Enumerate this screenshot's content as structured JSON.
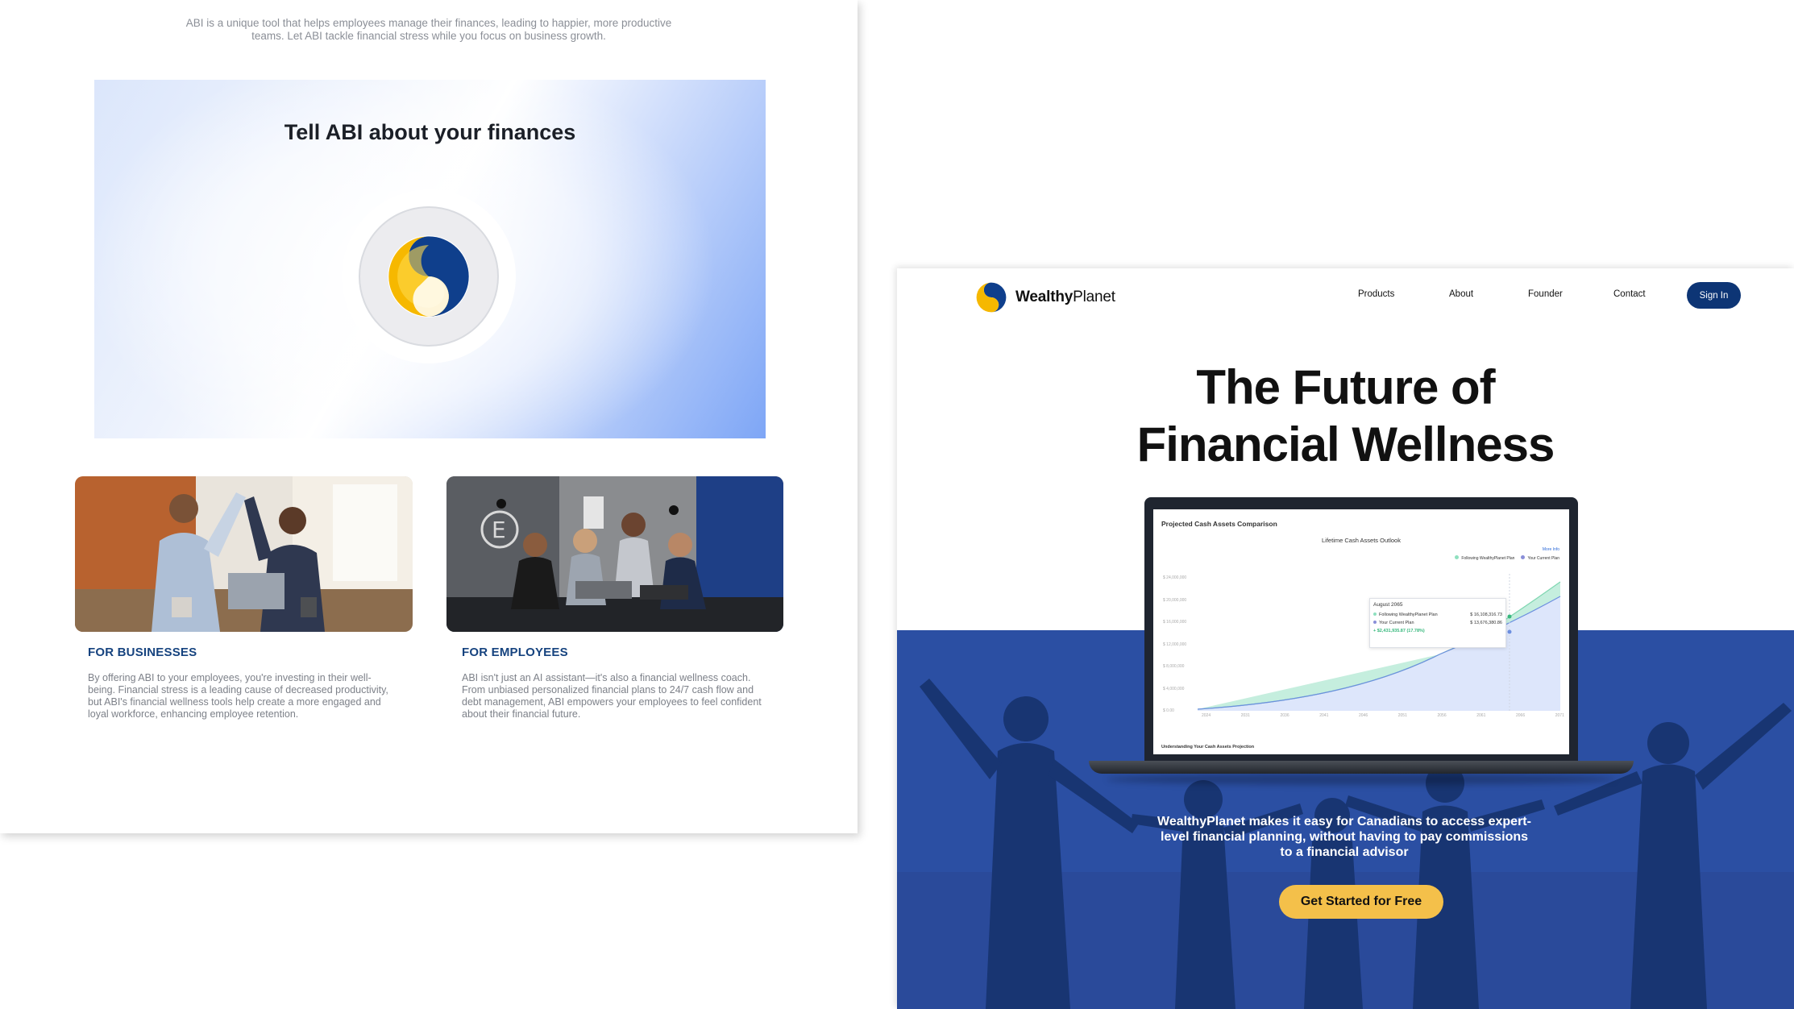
{
  "left": {
    "intro": "ABI is a unique tool that helps employees manage their finances, leading to happier, more productive teams. Let ABI tackle financial stress while you focus on business growth.",
    "card_title": "Tell ABI about your finances",
    "businesses": {
      "heading": "FOR BUSINESSES",
      "body": "By offering ABI to your employees, you're investing in their well-being. Financial stress is a leading cause of decreased productivity, but ABI's financial wellness tools help create a more engaged and loyal workforce, enhancing employee retention."
    },
    "employees": {
      "heading": "FOR EMPLOYEES",
      "body": "ABI isn't just an AI assistant—it's also a financial wellness coach. From unbiased personalized financial plans to 24/7 cash flow and debt management, ABI empowers your employees to feel confident about their financial future."
    }
  },
  "right": {
    "brand_bold": "Wealthy",
    "brand_rest": "Planet",
    "nav": [
      "Products",
      "About",
      "Founder",
      "Contact"
    ],
    "signin": "Sign In",
    "hero_line1": "The Future of",
    "hero_line2": "Financial Wellness",
    "subtitle": "WealthyPlanet makes it easy for Canadians to access expert-level financial planning, without having to pay commissions to a financial advisor",
    "cta": "Get Started for Free",
    "screen": {
      "title": "Projected Cash Assets Comparison",
      "chart_title": "Lifetime Cash Assets Outlook",
      "more_info": "More Info",
      "legend": [
        "Following WealthyPlanet Plan",
        "Your Current Plan"
      ],
      "y_ticks": [
        "$ 24,000,000",
        "$ 20,000,000",
        "$ 16,000,000",
        "$ 12,000,000",
        "$ 8,000,000",
        "$ 4,000,000",
        "$ 0.00"
      ],
      "x_ticks": [
        "2024",
        "2031",
        "2036",
        "2041",
        "2046",
        "2051",
        "2056",
        "2061",
        "2066",
        "2071"
      ],
      "tooltip": {
        "date": "August 2065",
        "row1_label": "Following WealthyPlanet Plan",
        "row1_value": "$ 16,108,316.73",
        "row2_label": "Your Current Plan",
        "row2_value": "$ 13,676,380.86",
        "diff": "+ $2,431,935.87 (17.78%)"
      },
      "footer": "Understanding Your Cash Assets Projection"
    },
    "colors": {
      "navy": "#0d3575",
      "hero_blue": "#2b4fa3",
      "cta_yellow": "#f4c04a",
      "green": "#37b87d"
    }
  }
}
